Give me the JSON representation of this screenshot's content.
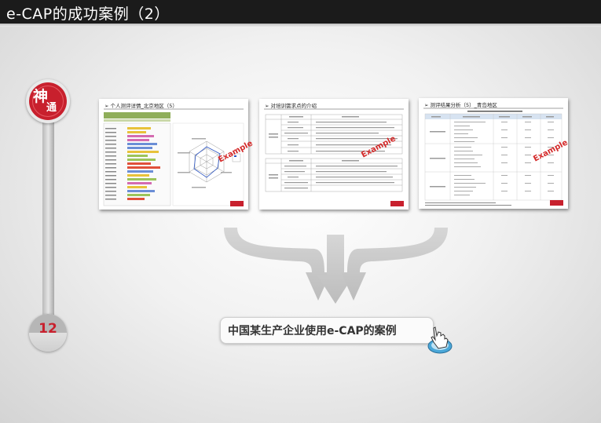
{
  "header": {
    "title": "e-CAP的成功案例（2）"
  },
  "timeline": {
    "badge_char_1": "神",
    "badge_char_2": "通",
    "page_number": "12"
  },
  "thumbnails": [
    {
      "title": "➢ 个人测评详情_北京地区（5）",
      "stamp": "Example"
    },
    {
      "title": "➢ 对培训需求点的介绍",
      "stamp": "Example"
    },
    {
      "title": "➢ 测评结果分析（5）_青岛地区",
      "stamp": "Example"
    }
  ],
  "caption": {
    "text": "中国某生产企业使用e-CAP的案例"
  },
  "colors": {
    "accent_red": "#c8202d",
    "title_bar": "#1b1b1b"
  }
}
